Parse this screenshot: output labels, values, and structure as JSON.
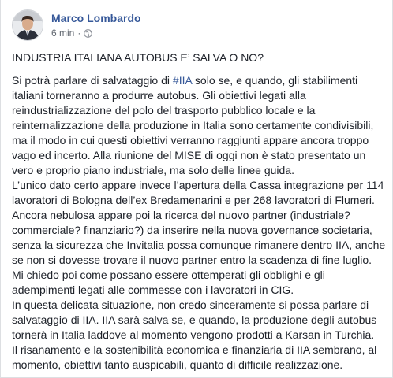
{
  "post": {
    "author": "Marco Lombardo",
    "time": "6 min",
    "separator": "·",
    "privacy_icon": "globe-icon",
    "headline": "INDUSTRIA ITALIANA AUTOBUS E’ SALVA O NO?",
    "p1_before": "Si potrà parlare di salvataggio di ",
    "hashtag": "#IIA",
    "p1_after": " solo se, e quando, gli stabilimenti italiani torneranno a produrre autobus. Gli obiettivi legati alla reindustrializzazione del polo del trasporto pubblico locale e la reinternalizzazione della produzione in Italia sono certamente condivisibili, ma il modo in cui questi obiettivi verranno raggiunti appare ancora troppo vago ed incerto. Alla riunione del MISE di oggi non è stato presentato un vero e proprio piano industriale, ma solo delle linee guida.",
    "p2": "L’unico dato certo appare invece l’apertura della Cassa integrazione per 114 lavoratori di Bologna dell’ex Bredamenarini e per 268 lavoratori di Flumeri. Ancora nebulosa appare poi la ricerca del nuovo partner (industriale? commerciale? finanziario?) da inserire nella nuova governance societaria, senza la sicurezza che Invitalia possa comunque rimanere dentro IIA, anche se non si dovesse trovare il nuovo partner entro la scadenza di fine luglio. Mi chiedo poi come possano essere ottemperati gli obblighi e gli adempimenti legati alle commesse con i lavoratori in CIG.",
    "p3": "In questa delicata situazione, non credo sinceramente si possa parlare di salvataggio di IIA. IIA sarà salva se, e quando, la produzione degli autobus tornerà in Italia laddove al momento vengono prodotti a Karsan in Turchia.",
    "p4": "Il risanamento e la sostenibilità economica e finanziaria di IIA sembrano, al momento, obiettivi tanto auspicabili, quanto di difficile realizzazione."
  },
  "colors": {
    "link": "#365899",
    "text": "#1d2129",
    "meta": "#616770"
  }
}
